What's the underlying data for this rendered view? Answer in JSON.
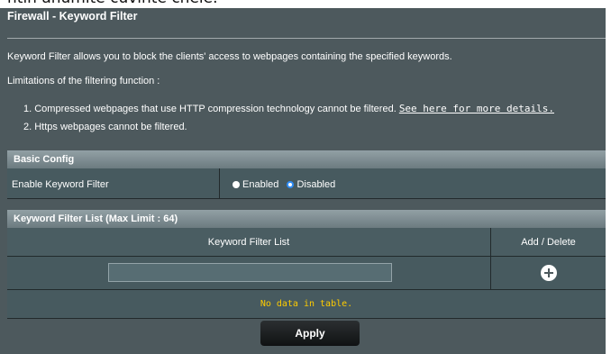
{
  "caption": "ntin anumite cuvinte cheie.",
  "title": "Firewall - Keyword Filter",
  "description": "Keyword Filter allows you to block the clients' access to webpages containing the specified keywords.",
  "limitations_heading": "Limitations of the filtering function :",
  "limitations": [
    "1. Compressed webpages that use HTTP compression technology cannot be filtered.",
    "2. Https webpages cannot be filtered."
  ],
  "details_link": "See here for more details.",
  "basic_config": {
    "heading": "Basic Config",
    "enable_label": "Enable Keyword Filter",
    "options": [
      "Enabled",
      "Disabled"
    ],
    "selected": "Disabled"
  },
  "keyword_list": {
    "heading": "Keyword Filter List (Max Limit : 64)",
    "columns": [
      "Keyword Filter List",
      "Add / Delete"
    ],
    "input_value": "",
    "empty_message": "No data in table."
  },
  "apply_label": "Apply",
  "colors": {
    "panel_bg": "#4d595d",
    "accent_yellow": "#ffcc00",
    "radio_selected": "#2f8df5"
  }
}
